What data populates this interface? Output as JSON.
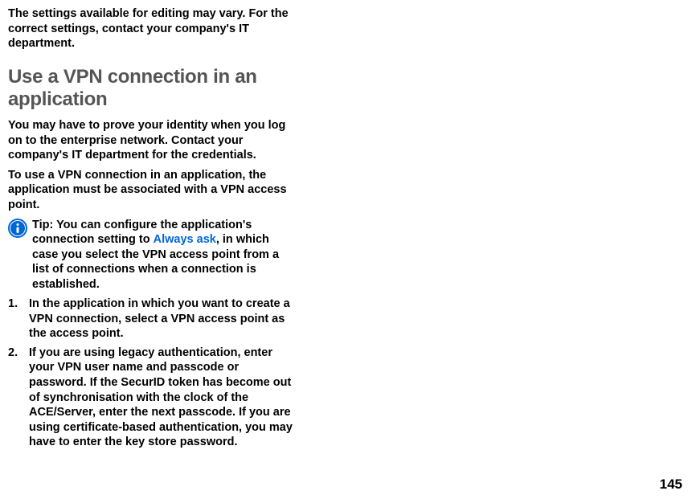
{
  "intro": "The settings available for editing may vary. For the correct settings, contact your company's IT department.",
  "heading": "Use a VPN connection in an application",
  "para1": "You may have to prove your identity when you log on to the enterprise network. Contact your company's IT department for the credentials.",
  "para2": "To use a VPN connection in an application, the application must be associated with a VPN access point.",
  "tip": {
    "label": "Tip:",
    "prefix": " You can configure the application's connection setting to ",
    "highlight": "Always ask",
    "suffix": ", in which case you select the VPN access point from a list of connections when a connection is established."
  },
  "steps": [
    "In the application in which you want to create a VPN connection, select a VPN access point as the access point.",
    "If you are using legacy authentication, enter your VPN user name and passcode or password. If the SecurID token has become out of synchronisation with the clock of the ACE/Server, enter the next passcode. If you are using certificate-based authentication, you may have to enter the key store password."
  ],
  "page_number": "145"
}
